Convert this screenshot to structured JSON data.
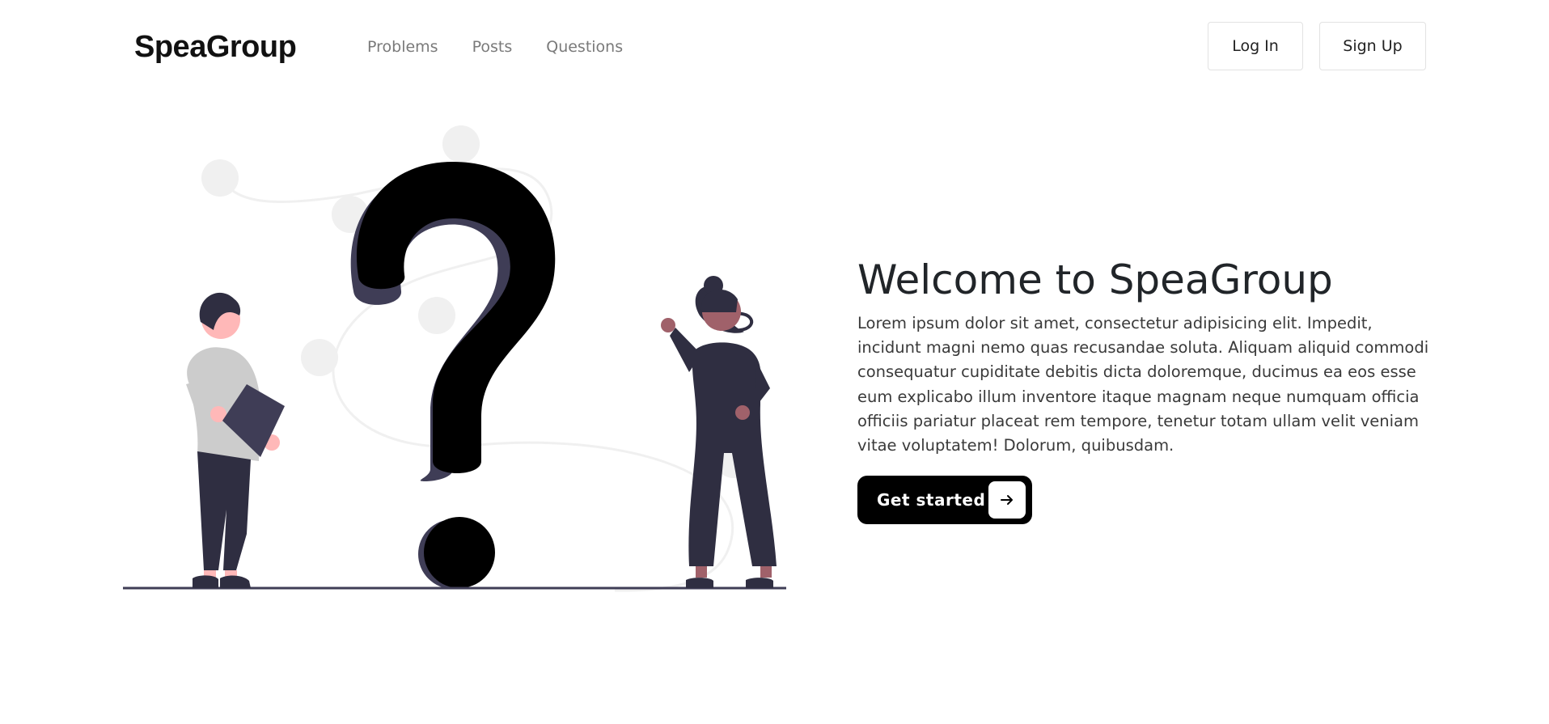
{
  "nav": {
    "brand": "SpeaGroup",
    "links": [
      "Problems",
      "Posts",
      "Questions"
    ],
    "login_label": "Log In",
    "signup_label": "Sign Up"
  },
  "hero": {
    "title": "Welcome to SpeaGroup",
    "text": "Lorem ipsum dolor sit amet, consectetur adipisicing elit. Impedit, incidunt magni nemo quas recusandae soluta. Aliquam aliquid commodi consequatur cupiditate debitis dicta doloremque, ducimus ea eos esse eum explicabo illum inventore itaque magnam neque numquam officia officiis pariatur placeat rem tempore, tenetur totam ullam velit veniam vitae voluptatem! Dolorum, quibusdam.",
    "cta_label": "Get started",
    "cta_icon": "arrow-right-icon"
  },
  "illustration": {
    "icon": "question-people-illustration"
  },
  "colors": {
    "brand": "#111111",
    "nav_link": "#7a7a7a",
    "cta_bg": "#000000",
    "cta_text": "#ffffff",
    "illustration_dark": "#2f2e41",
    "illustration_accent": "#3f3d56",
    "skin_light": "#ffb8b8",
    "skin_dark": "#a0616a",
    "shirt": "#cccccc",
    "decor": "#f0f0f0"
  }
}
